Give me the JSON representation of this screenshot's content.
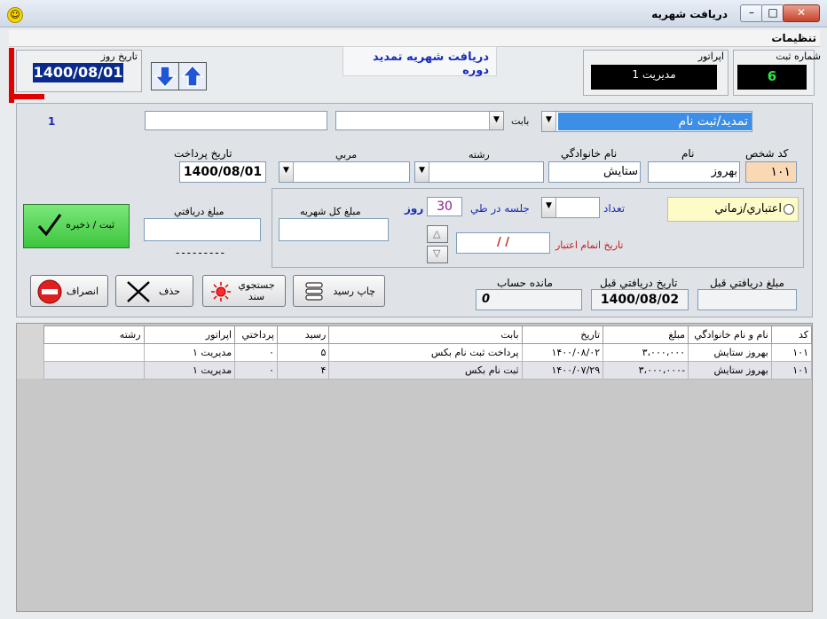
{
  "window": {
    "title": "دريافت شهريه"
  },
  "menu": {
    "settings": "تنظيمات"
  },
  "header": {
    "form_title": "دريافت شهريه تمديد دوره",
    "date_label": "تاريخ روز",
    "date_value": "1400/08/01",
    "operator_label": "اپراتور",
    "operator_value": "مديريت 1",
    "reg_no_label": "شماره ثبت",
    "reg_no_value": "6"
  },
  "form": {
    "row_counter": "1",
    "type_value": "تمديد/ثبت نام",
    "babat_label": "بابت",
    "person_code_label": "كد شخص",
    "person_code_value": "۱۰۱",
    "first_name_label": "نام",
    "first_name_value": "بهروز",
    "last_name_label": "نام خانوادگي",
    "last_name_value": "ستايش",
    "field_label": "رشته",
    "coach_label": "مربي",
    "pay_date_label": "تاريخ پرداخت",
    "pay_date_value": "1400/08/01",
    "credit_radio_label": "اعتباري/زماني",
    "count_label": "تعداد",
    "session_label": "جلسه در طي",
    "days_value": "30",
    "days_label": "روز",
    "expiry_label": "تاريخ اتمام اعتبار",
    "expiry_value": "/ /",
    "total_label": "مبلغ كل شهريه",
    "received_label": "مبلغ دريافتي",
    "dashes": "---------",
    "save_label": "ثبت / ذخيره",
    "prev_received_label": "مبلغ دريافتي قبل",
    "prev_date_label": "تاريخ دريافتي قبل",
    "prev_date_value": "1400/08/02",
    "balance_label": "مانده حساب",
    "balance_value": "0"
  },
  "buttons": {
    "print_label": "چاپ رسيد",
    "search_label": "جستجوي سند",
    "delete_label": "حذف",
    "cancel_label": "انصراف"
  },
  "table": {
    "headers": [
      "كد",
      "نام و نام خانوادگي",
      "مبلغ",
      "تاريخ",
      "بابت",
      "رسيد",
      "پرداختي",
      "اپراتور",
      "رشته"
    ],
    "rows": [
      [
        "۱۰۱",
        "بهروز ستايش",
        "۳،۰۰۰،۰۰۰",
        "۱۴۰۰/۰۸/۰۲",
        "پرداخت ثبت نام بكس",
        "۵",
        "۰",
        "مديريت ۱",
        ""
      ],
      [
        "۱۰۱",
        "بهروز ستايش",
        "-۳،۰۰۰،۰۰۰",
        "۱۴۰۰/۰۷/۲۹",
        "ثبت نام بكس",
        "۴",
        "۰",
        "مديريت ۱",
        ""
      ]
    ]
  },
  "colors": {
    "accent_red": "#e00000",
    "title_blue": "#1a2db5",
    "code_bg": "#fbd8b4",
    "save_green": "#58d858",
    "selected_blue": "#3d8ee6"
  }
}
